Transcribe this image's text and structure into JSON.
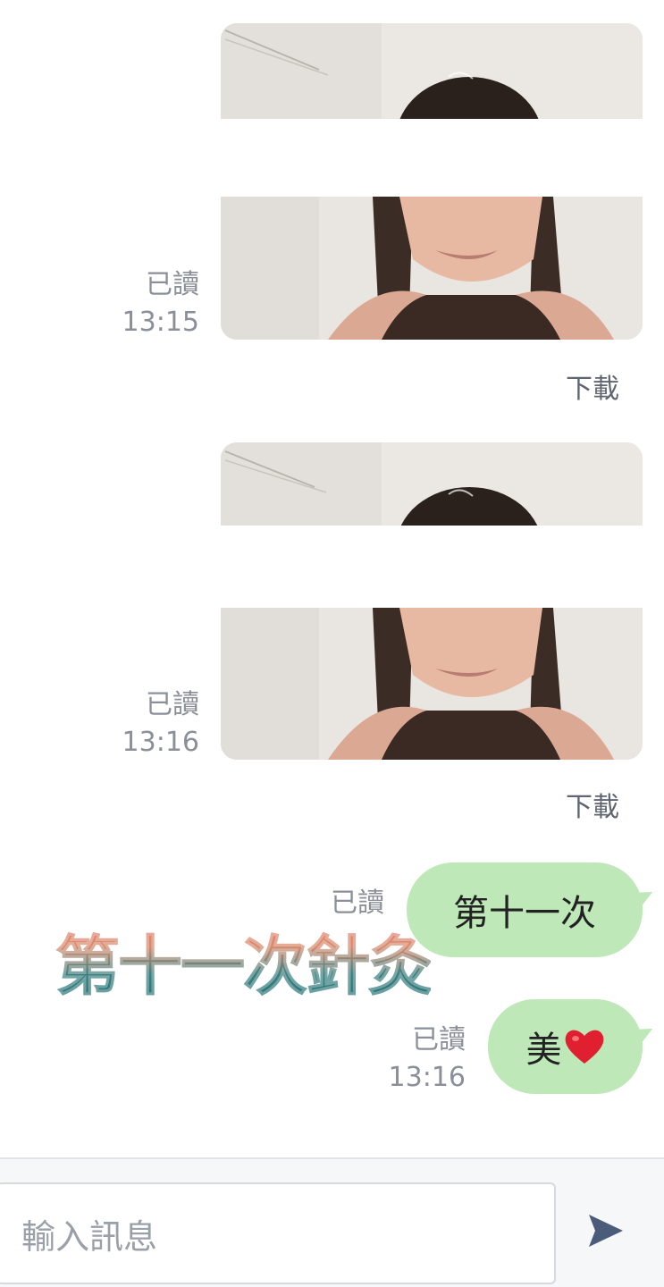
{
  "messages": [
    {
      "type": "video",
      "read_label": "已讀",
      "time": "13:15",
      "download_label": "下載"
    },
    {
      "type": "video",
      "read_label": "已讀",
      "time": "13:16",
      "download_label": "下載"
    },
    {
      "type": "text",
      "read_label": "已讀",
      "text": "第十一次"
    },
    {
      "type": "text",
      "read_label": "已讀",
      "time": "13:16",
      "text": "美",
      "emoji": "heart-icon"
    }
  ],
  "sticker": {
    "text": "第十一次針灸"
  },
  "composer": {
    "placeholder": "輸入訊息",
    "send_icon": "send-icon"
  },
  "colors": {
    "bubble": "#bfe8b8",
    "meta_text": "#8a8f99",
    "send_icon": "#4b5b7a",
    "heart": "#e02030"
  }
}
